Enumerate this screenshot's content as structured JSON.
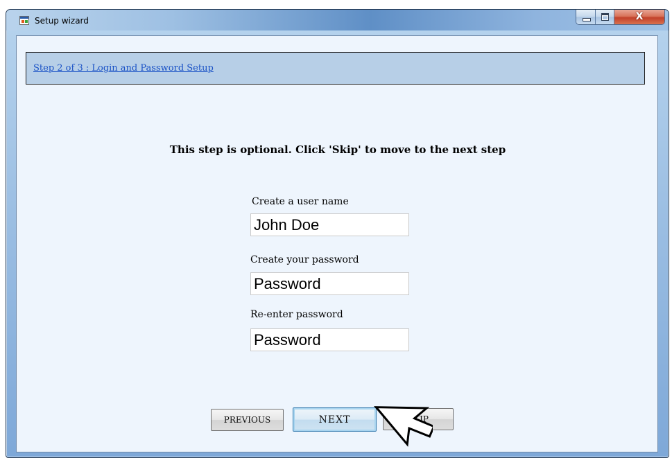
{
  "window": {
    "title": "Setup wizard",
    "controls": {
      "close_glyph": "X"
    }
  },
  "header": {
    "step_link": "Step 2 of 3 : Login and Password Setup"
  },
  "main": {
    "instruction": "This step is optional. Click 'Skip' to move to the next step",
    "fields": {
      "username": {
        "label": "Create a user name",
        "value": "John Doe"
      },
      "password": {
        "label": "Create your password",
        "value": "Password"
      },
      "reenter": {
        "label": "Re-enter password",
        "value": "Password"
      }
    }
  },
  "buttons": {
    "previous": "PREVIOUS",
    "next": "NEXT",
    "skip": "SKIP"
  },
  "icons": [
    "app-icon",
    "minimize-icon",
    "maximize-icon",
    "close-icon",
    "mouse-pointer-icon"
  ],
  "colors": {
    "link": "#1a52c6",
    "header_band": "#b7cfe7",
    "close_button": "#c2412a",
    "client_bg": "#eef5fd"
  }
}
